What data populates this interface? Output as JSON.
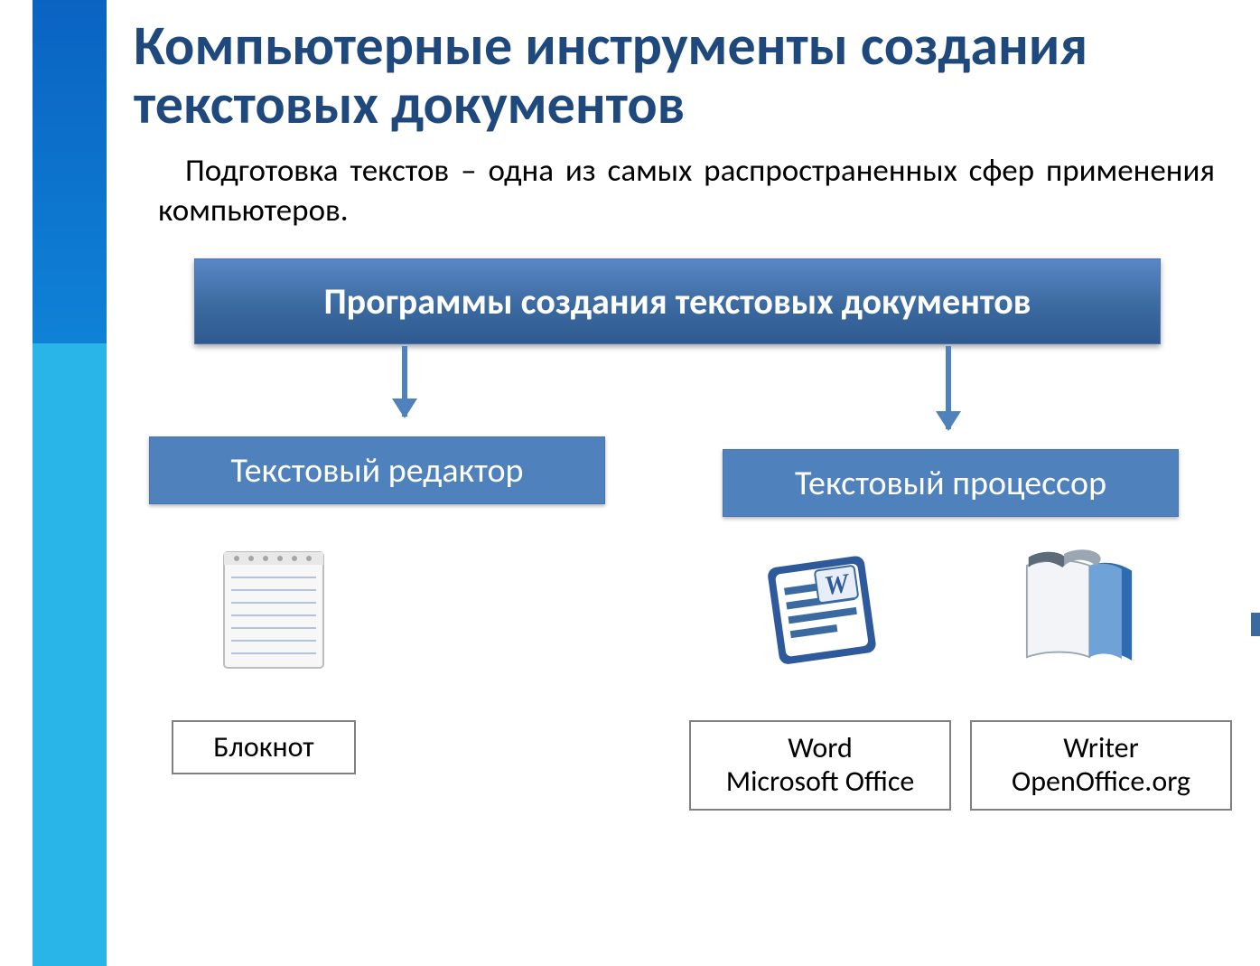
{
  "title": "Компьютерные инструменты создания текстовых документов",
  "subtitle": "Подготовка текстов – одна из самых распространенных сфер применения компьютеров.",
  "main_box": "Программы создания текстовых документов",
  "branches": {
    "left": "Текстовый редактор",
    "right": "Текстовый процессор"
  },
  "apps": {
    "notepad": {
      "caption": "Блокнот"
    },
    "word": {
      "caption_line1": "Word",
      "caption_line2": "Microsoft Office"
    },
    "writer": {
      "caption_line1": "Writer",
      "caption_line2": "OpenOffice.org"
    }
  },
  "colors": {
    "title": "#1f497d",
    "box_gradient_top": "#5a87c6",
    "box_gradient_bottom": "#2f5a90",
    "subbox": "#4f81bd",
    "sidebar_top": "#0a63c2",
    "sidebar_bottom": "#29b5e8"
  }
}
